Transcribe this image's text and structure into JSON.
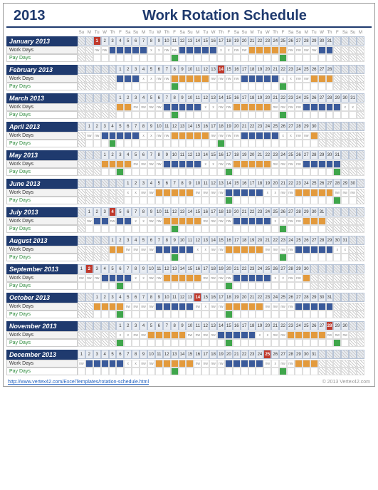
{
  "year": "2013",
  "title": "Work Rotation Schedule",
  "dow": [
    "Su",
    "M",
    "Tu",
    "W",
    "Th",
    "F",
    "Sa",
    "Su",
    "M",
    "Tu",
    "W",
    "Th",
    "F",
    "Sa",
    "Su",
    "M",
    "Tu",
    "W",
    "Th",
    "F",
    "Sa",
    "Su",
    "M",
    "Tu",
    "W",
    "Th",
    "F",
    "Sa",
    "Su",
    "M",
    "Tu",
    "W",
    "Th",
    "F",
    "Sa",
    "Su",
    "M"
  ],
  "row_labels": {
    "work": "Work Days",
    "pay": "Pay Days"
  },
  "footer": {
    "url": "http://www.vertex42.com/ExcelTemplates/rotation-schedule.html",
    "copy": "© 2013 Vertex42.com"
  },
  "months": [
    {
      "name": "January 2013",
      "offset": 2,
      "days": 31,
      "today": 1,
      "work": [
        "nw",
        "nw",
        "blue",
        "blue",
        "blue",
        "blue",
        "blue",
        "x",
        "x",
        "nw",
        "nw",
        "blue",
        "blue",
        "blue",
        "blue",
        "blue",
        "x",
        "x",
        "nw",
        "nw",
        "orange",
        "orange",
        "orange",
        "orange",
        "orange",
        "nw",
        "nw",
        "nw",
        "nw",
        "blue",
        "blue"
      ],
      "pay": [
        "",
        "",
        "",
        "",
        "",
        "",
        "",
        "",
        "",
        "",
        "green",
        "",
        "",
        "",
        "",
        "",
        "",
        "",
        "",
        "",
        "",
        "",
        "",
        "",
        "green",
        "",
        "",
        "",
        "",
        "",
        ""
      ]
    },
    {
      "name": "February 2013",
      "offset": 5,
      "days": 28,
      "today": 14,
      "work": [
        "blue",
        "blue",
        "blue",
        "x",
        "x",
        "nw",
        "nw",
        "orange",
        "orange",
        "orange",
        "orange",
        "orange",
        "nw",
        "nw",
        "nw",
        "nw",
        "blue",
        "blue",
        "blue",
        "blue",
        "blue",
        "x",
        "x",
        "nw",
        "nw",
        "orange",
        "orange",
        "orange"
      ],
      "pay": [
        "",
        "",
        "",
        "",
        "",
        "",
        "",
        "green",
        "",
        "",
        "",
        "",
        "",
        "",
        "",
        "",
        "",
        "",
        "",
        "",
        "",
        "green",
        "",
        "",
        "",
        "",
        "",
        ""
      ]
    },
    {
      "name": "March 2013",
      "offset": 5,
      "days": 31,
      "today": null,
      "work": [
        "orange",
        "orange",
        "nw",
        "nw",
        "nw",
        "nw",
        "blue",
        "blue",
        "blue",
        "blue",
        "blue",
        "x",
        "x",
        "nw",
        "nw",
        "orange",
        "orange",
        "orange",
        "orange",
        "orange",
        "nw",
        "nw",
        "nw",
        "nw",
        "blue",
        "blue",
        "blue",
        "blue",
        "blue",
        "x",
        "x"
      ],
      "pay": [
        "",
        "",
        "",
        "",
        "",
        "",
        "",
        "green",
        "",
        "",
        "",
        "",
        "",
        "",
        "",
        "",
        "",
        "",
        "",
        "",
        "",
        "green",
        "",
        "",
        "",
        "",
        "",
        "",
        "",
        "",
        ""
      ]
    },
    {
      "name": "April 2013",
      "offset": 1,
      "days": 30,
      "today": null,
      "work": [
        "nw",
        "nw",
        "blue",
        "blue",
        "blue",
        "blue",
        "blue",
        "x",
        "x",
        "nw",
        "nw",
        "orange",
        "orange",
        "orange",
        "orange",
        "orange",
        "nw",
        "nw",
        "nw",
        "nw",
        "blue",
        "blue",
        "blue",
        "blue",
        "blue",
        "x",
        "x",
        "nw",
        "nw",
        "orange"
      ],
      "pay": [
        "",
        "",
        "",
        "green",
        "",
        "",
        "",
        "",
        "",
        "",
        "",
        "",
        "",
        "",
        "",
        "",
        "",
        "green",
        "",
        "",
        "",
        "",
        "",
        "",
        "",
        "",
        "",
        "",
        "",
        ""
      ]
    },
    {
      "name": "May 2013",
      "offset": 3,
      "days": 31,
      "today": null,
      "work": [
        "orange",
        "orange",
        "orange",
        "orange",
        "nw",
        "nw",
        "nw",
        "nw",
        "blue",
        "blue",
        "blue",
        "blue",
        "blue",
        "x",
        "x",
        "nw",
        "nw",
        "orange",
        "orange",
        "orange",
        "orange",
        "orange",
        "nw",
        "nw",
        "nw",
        "nw",
        "blue",
        "blue",
        "blue",
        "blue",
        "blue"
      ],
      "pay": [
        "",
        "",
        "green",
        "",
        "",
        "",
        "",
        "",
        "",
        "",
        "",
        "",
        "",
        "",
        "",
        "",
        "green",
        "",
        "",
        "",
        "",
        "",
        "",
        "",
        "",
        "",
        "",
        "",
        "",
        "",
        "green"
      ]
    },
    {
      "name": "June 2013",
      "offset": 6,
      "days": 30,
      "today": null,
      "work": [
        "x",
        "x",
        "nw",
        "nw",
        "orange",
        "orange",
        "orange",
        "orange",
        "orange",
        "nw",
        "nw",
        "nw",
        "nw",
        "blue",
        "blue",
        "blue",
        "blue",
        "blue",
        "x",
        "x",
        "nw",
        "nw",
        "orange",
        "orange",
        "orange",
        "orange",
        "orange",
        "nw",
        "nw",
        "nw"
      ],
      "pay": [
        "",
        "",
        "",
        "",
        "",
        "",
        "",
        "",
        "",
        "",
        "",
        "",
        "",
        "green",
        "",
        "",
        "",
        "",
        "",
        "",
        "",
        "",
        "",
        "",
        "",
        "",
        "",
        "green",
        "",
        ""
      ]
    },
    {
      "name": "July 2013",
      "offset": 1,
      "days": 31,
      "today": 4,
      "work": [
        "nw",
        "blue",
        "blue",
        "nw",
        "blue",
        "blue",
        "x",
        "x",
        "nw",
        "nw",
        "orange",
        "orange",
        "orange",
        "orange",
        "orange",
        "nw",
        "nw",
        "nw",
        "nw",
        "blue",
        "blue",
        "blue",
        "blue",
        "blue",
        "x",
        "x",
        "nw",
        "nw",
        "orange",
        "orange",
        "orange"
      ],
      "pay": [
        "",
        "",
        "",
        "",
        "",
        "",
        "",
        "",
        "",
        "",
        "",
        "green",
        "",
        "",
        "",
        "",
        "",
        "",
        "",
        "",
        "",
        "",
        "",
        "",
        "",
        "green",
        "",
        "",
        "",
        "",
        ""
      ]
    },
    {
      "name": "August 2013",
      "offset": 4,
      "days": 31,
      "today": null,
      "work": [
        "orange",
        "orange",
        "nw",
        "nw",
        "nw",
        "nw",
        "blue",
        "blue",
        "blue",
        "blue",
        "blue",
        "x",
        "x",
        "nw",
        "nw",
        "orange",
        "orange",
        "orange",
        "orange",
        "orange",
        "nw",
        "nw",
        "nw",
        "nw",
        "blue",
        "blue",
        "blue",
        "blue",
        "blue",
        "x",
        "x"
      ],
      "pay": [
        "",
        "",
        "",
        "",
        "",
        "",
        "",
        "",
        "green",
        "",
        "",
        "",
        "",
        "",
        "",
        "",
        "",
        "",
        "",
        "",
        "",
        "",
        "green",
        "",
        "",
        "",
        "",
        "",
        "",
        "",
        ""
      ]
    },
    {
      "name": "September 2013",
      "offset": 0,
      "days": 30,
      "today": 2,
      "work": [
        "nw",
        "nw",
        "nw",
        "blue",
        "blue",
        "blue",
        "blue",
        "x",
        "x",
        "nw",
        "nw",
        "orange",
        "orange",
        "orange",
        "orange",
        "orange",
        "nw",
        "nw",
        "nw",
        "nw",
        "blue",
        "blue",
        "blue",
        "blue",
        "blue",
        "x",
        "x",
        "nw",
        "nw",
        "orange"
      ],
      "pay": [
        "",
        "",
        "",
        "",
        "",
        "green",
        "",
        "",
        "",
        "",
        "",
        "",
        "",
        "",
        "",
        "",
        "",
        "",
        "",
        "green",
        "",
        "",
        "",
        "",
        "",
        "",
        "",
        "",
        "",
        ""
      ]
    },
    {
      "name": "October 2013",
      "offset": 2,
      "days": 31,
      "today": 14,
      "work": [
        "orange",
        "orange",
        "orange",
        "orange",
        "nw",
        "nw",
        "nw",
        "nw",
        "blue",
        "blue",
        "blue",
        "blue",
        "blue",
        "nw",
        "x",
        "nw",
        "nw",
        "orange",
        "orange",
        "orange",
        "orange",
        "orange",
        "nw",
        "nw",
        "nw",
        "nw",
        "blue",
        "blue",
        "blue",
        "blue",
        "blue"
      ],
      "pay": [
        "",
        "",
        "",
        "green",
        "",
        "",
        "",
        "",
        "",
        "",
        "",
        "",
        "",
        "",
        "",
        "",
        "",
        "green",
        "",
        "",
        "",
        "",
        "",
        "",
        "",
        "",
        "",
        "",
        "",
        "",
        ""
      ]
    },
    {
      "name": "November 2013",
      "offset": 5,
      "days": 30,
      "today": 28,
      "work": [
        "x",
        "x",
        "nw",
        "nw",
        "orange",
        "orange",
        "orange",
        "orange",
        "orange",
        "nw",
        "nw",
        "nw",
        "nw",
        "blue",
        "blue",
        "blue",
        "blue",
        "blue",
        "x",
        "x",
        "nw",
        "nw",
        "orange",
        "orange",
        "orange",
        "orange",
        "orange",
        "nw",
        "nw",
        "nw"
      ],
      "pay": [
        "green",
        "",
        "",
        "",
        "",
        "",
        "",
        "",
        "",
        "",
        "",
        "",
        "",
        "",
        "green",
        "",
        "",
        "",
        "",
        "",
        "",
        "",
        "",
        "",
        "",
        "",
        "",
        "",
        "green",
        ""
      ]
    },
    {
      "name": "December 2013",
      "offset": 0,
      "days": 31,
      "today": 25,
      "work": [
        "nw",
        "blue",
        "blue",
        "blue",
        "blue",
        "blue",
        "x",
        "x",
        "nw",
        "nw",
        "orange",
        "orange",
        "orange",
        "orange",
        "orange",
        "nw",
        "nw",
        "nw",
        "nw",
        "blue",
        "blue",
        "blue",
        "blue",
        "blue",
        "nw",
        "x",
        "nw",
        "nw",
        "orange",
        "orange",
        "orange"
      ],
      "pay": [
        "",
        "",
        "",
        "",
        "",
        "",
        "",
        "",
        "",
        "",
        "",
        "",
        "green",
        "",
        "",
        "",
        "",
        "",
        "",
        "",
        "",
        "",
        "",
        "",
        "",
        "",
        "green",
        "",
        "",
        "",
        ""
      ]
    }
  ]
}
